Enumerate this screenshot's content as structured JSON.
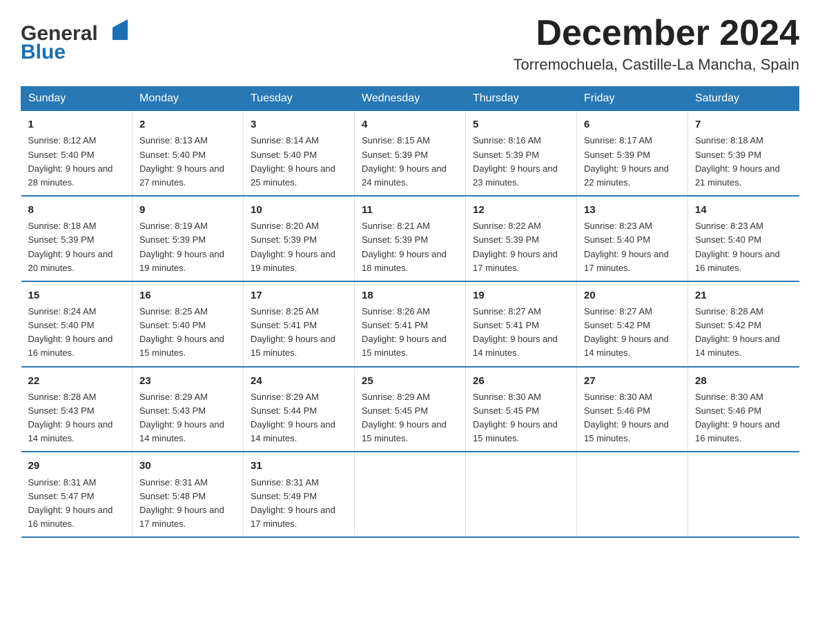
{
  "header": {
    "month_title": "December 2024",
    "location": "Torremochuela, Castille-La Mancha, Spain"
  },
  "logo": {
    "line1": "General",
    "line2": "Blue"
  },
  "days_of_week": [
    "Sunday",
    "Monday",
    "Tuesday",
    "Wednesday",
    "Thursday",
    "Friday",
    "Saturday"
  ],
  "weeks": [
    [
      {
        "day": "1",
        "sunrise": "8:12 AM",
        "sunset": "5:40 PM",
        "daylight": "9 hours and 28 minutes."
      },
      {
        "day": "2",
        "sunrise": "8:13 AM",
        "sunset": "5:40 PM",
        "daylight": "9 hours and 27 minutes."
      },
      {
        "day": "3",
        "sunrise": "8:14 AM",
        "sunset": "5:40 PM",
        "daylight": "9 hours and 25 minutes."
      },
      {
        "day": "4",
        "sunrise": "8:15 AM",
        "sunset": "5:39 PM",
        "daylight": "9 hours and 24 minutes."
      },
      {
        "day": "5",
        "sunrise": "8:16 AM",
        "sunset": "5:39 PM",
        "daylight": "9 hours and 23 minutes."
      },
      {
        "day": "6",
        "sunrise": "8:17 AM",
        "sunset": "5:39 PM",
        "daylight": "9 hours and 22 minutes."
      },
      {
        "day": "7",
        "sunrise": "8:18 AM",
        "sunset": "5:39 PM",
        "daylight": "9 hours and 21 minutes."
      }
    ],
    [
      {
        "day": "8",
        "sunrise": "8:18 AM",
        "sunset": "5:39 PM",
        "daylight": "9 hours and 20 minutes."
      },
      {
        "day": "9",
        "sunrise": "8:19 AM",
        "sunset": "5:39 PM",
        "daylight": "9 hours and 19 minutes."
      },
      {
        "day": "10",
        "sunrise": "8:20 AM",
        "sunset": "5:39 PM",
        "daylight": "9 hours and 19 minutes."
      },
      {
        "day": "11",
        "sunrise": "8:21 AM",
        "sunset": "5:39 PM",
        "daylight": "9 hours and 18 minutes."
      },
      {
        "day": "12",
        "sunrise": "8:22 AM",
        "sunset": "5:39 PM",
        "daylight": "9 hours and 17 minutes."
      },
      {
        "day": "13",
        "sunrise": "8:23 AM",
        "sunset": "5:40 PM",
        "daylight": "9 hours and 17 minutes."
      },
      {
        "day": "14",
        "sunrise": "8:23 AM",
        "sunset": "5:40 PM",
        "daylight": "9 hours and 16 minutes."
      }
    ],
    [
      {
        "day": "15",
        "sunrise": "8:24 AM",
        "sunset": "5:40 PM",
        "daylight": "9 hours and 16 minutes."
      },
      {
        "day": "16",
        "sunrise": "8:25 AM",
        "sunset": "5:40 PM",
        "daylight": "9 hours and 15 minutes."
      },
      {
        "day": "17",
        "sunrise": "8:25 AM",
        "sunset": "5:41 PM",
        "daylight": "9 hours and 15 minutes."
      },
      {
        "day": "18",
        "sunrise": "8:26 AM",
        "sunset": "5:41 PM",
        "daylight": "9 hours and 15 minutes."
      },
      {
        "day": "19",
        "sunrise": "8:27 AM",
        "sunset": "5:41 PM",
        "daylight": "9 hours and 14 minutes."
      },
      {
        "day": "20",
        "sunrise": "8:27 AM",
        "sunset": "5:42 PM",
        "daylight": "9 hours and 14 minutes."
      },
      {
        "day": "21",
        "sunrise": "8:28 AM",
        "sunset": "5:42 PM",
        "daylight": "9 hours and 14 minutes."
      }
    ],
    [
      {
        "day": "22",
        "sunrise": "8:28 AM",
        "sunset": "5:43 PM",
        "daylight": "9 hours and 14 minutes."
      },
      {
        "day": "23",
        "sunrise": "8:29 AM",
        "sunset": "5:43 PM",
        "daylight": "9 hours and 14 minutes."
      },
      {
        "day": "24",
        "sunrise": "8:29 AM",
        "sunset": "5:44 PM",
        "daylight": "9 hours and 14 minutes."
      },
      {
        "day": "25",
        "sunrise": "8:29 AM",
        "sunset": "5:45 PM",
        "daylight": "9 hours and 15 minutes."
      },
      {
        "day": "26",
        "sunrise": "8:30 AM",
        "sunset": "5:45 PM",
        "daylight": "9 hours and 15 minutes."
      },
      {
        "day": "27",
        "sunrise": "8:30 AM",
        "sunset": "5:46 PM",
        "daylight": "9 hours and 15 minutes."
      },
      {
        "day": "28",
        "sunrise": "8:30 AM",
        "sunset": "5:46 PM",
        "daylight": "9 hours and 16 minutes."
      }
    ],
    [
      {
        "day": "29",
        "sunrise": "8:31 AM",
        "sunset": "5:47 PM",
        "daylight": "9 hours and 16 minutes."
      },
      {
        "day": "30",
        "sunrise": "8:31 AM",
        "sunset": "5:48 PM",
        "daylight": "9 hours and 17 minutes."
      },
      {
        "day": "31",
        "sunrise": "8:31 AM",
        "sunset": "5:49 PM",
        "daylight": "9 hours and 17 minutes."
      },
      null,
      null,
      null,
      null
    ]
  ]
}
